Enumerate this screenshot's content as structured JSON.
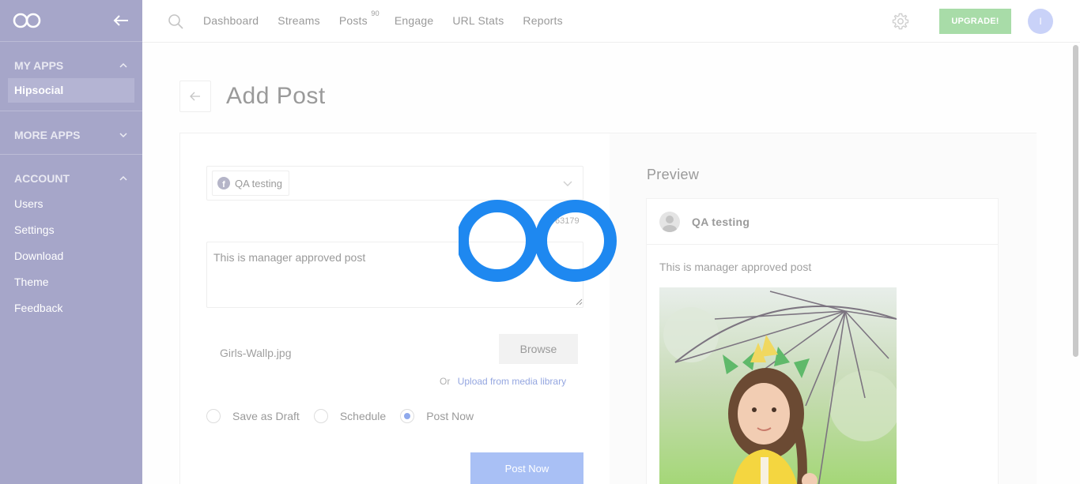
{
  "sidebar": {
    "sections": {
      "my_apps": {
        "title": "MY APPS",
        "items": [
          {
            "label": "Hipsocial"
          }
        ]
      },
      "more_apps": {
        "title": "MORE APPS"
      },
      "account": {
        "title": "ACCOUNT",
        "items": [
          {
            "label": "Users"
          },
          {
            "label": "Settings"
          },
          {
            "label": "Download"
          },
          {
            "label": "Theme"
          },
          {
            "label": "Feedback"
          }
        ]
      }
    }
  },
  "topbar": {
    "nav": [
      {
        "label": "Dashboard"
      },
      {
        "label": "Streams"
      },
      {
        "label": "Posts",
        "badge": "90"
      },
      {
        "label": "Engage"
      },
      {
        "label": "URL Stats"
      },
      {
        "label": "Reports"
      }
    ],
    "upgrade_label": "UPGRADE!",
    "avatar_initial": "I"
  },
  "page": {
    "title": "Add Post"
  },
  "form": {
    "account_name": "QA testing",
    "account_icon": "f",
    "char_count": "63179",
    "post_text": "This is manager approved post",
    "file_name": "Girls-Wallp.jpg",
    "browse_label": "Browse",
    "media_or": "Or",
    "media_link": "Upload from media library",
    "options": [
      {
        "label": "Save as Draft",
        "checked": false
      },
      {
        "label": "Schedule",
        "checked": false
      },
      {
        "label": "Post Now",
        "checked": true
      }
    ],
    "submit_label": "Post Now"
  },
  "preview": {
    "title": "Preview",
    "account_name": "QA testing",
    "text": "This is manager approved post"
  },
  "colors": {
    "sidebar_bg": "#a6a6c9",
    "upgrade_bg": "#a8dca8",
    "primary_button": "#a9c0f5",
    "loader": "#1e88f0",
    "link": "#94a6e0"
  }
}
